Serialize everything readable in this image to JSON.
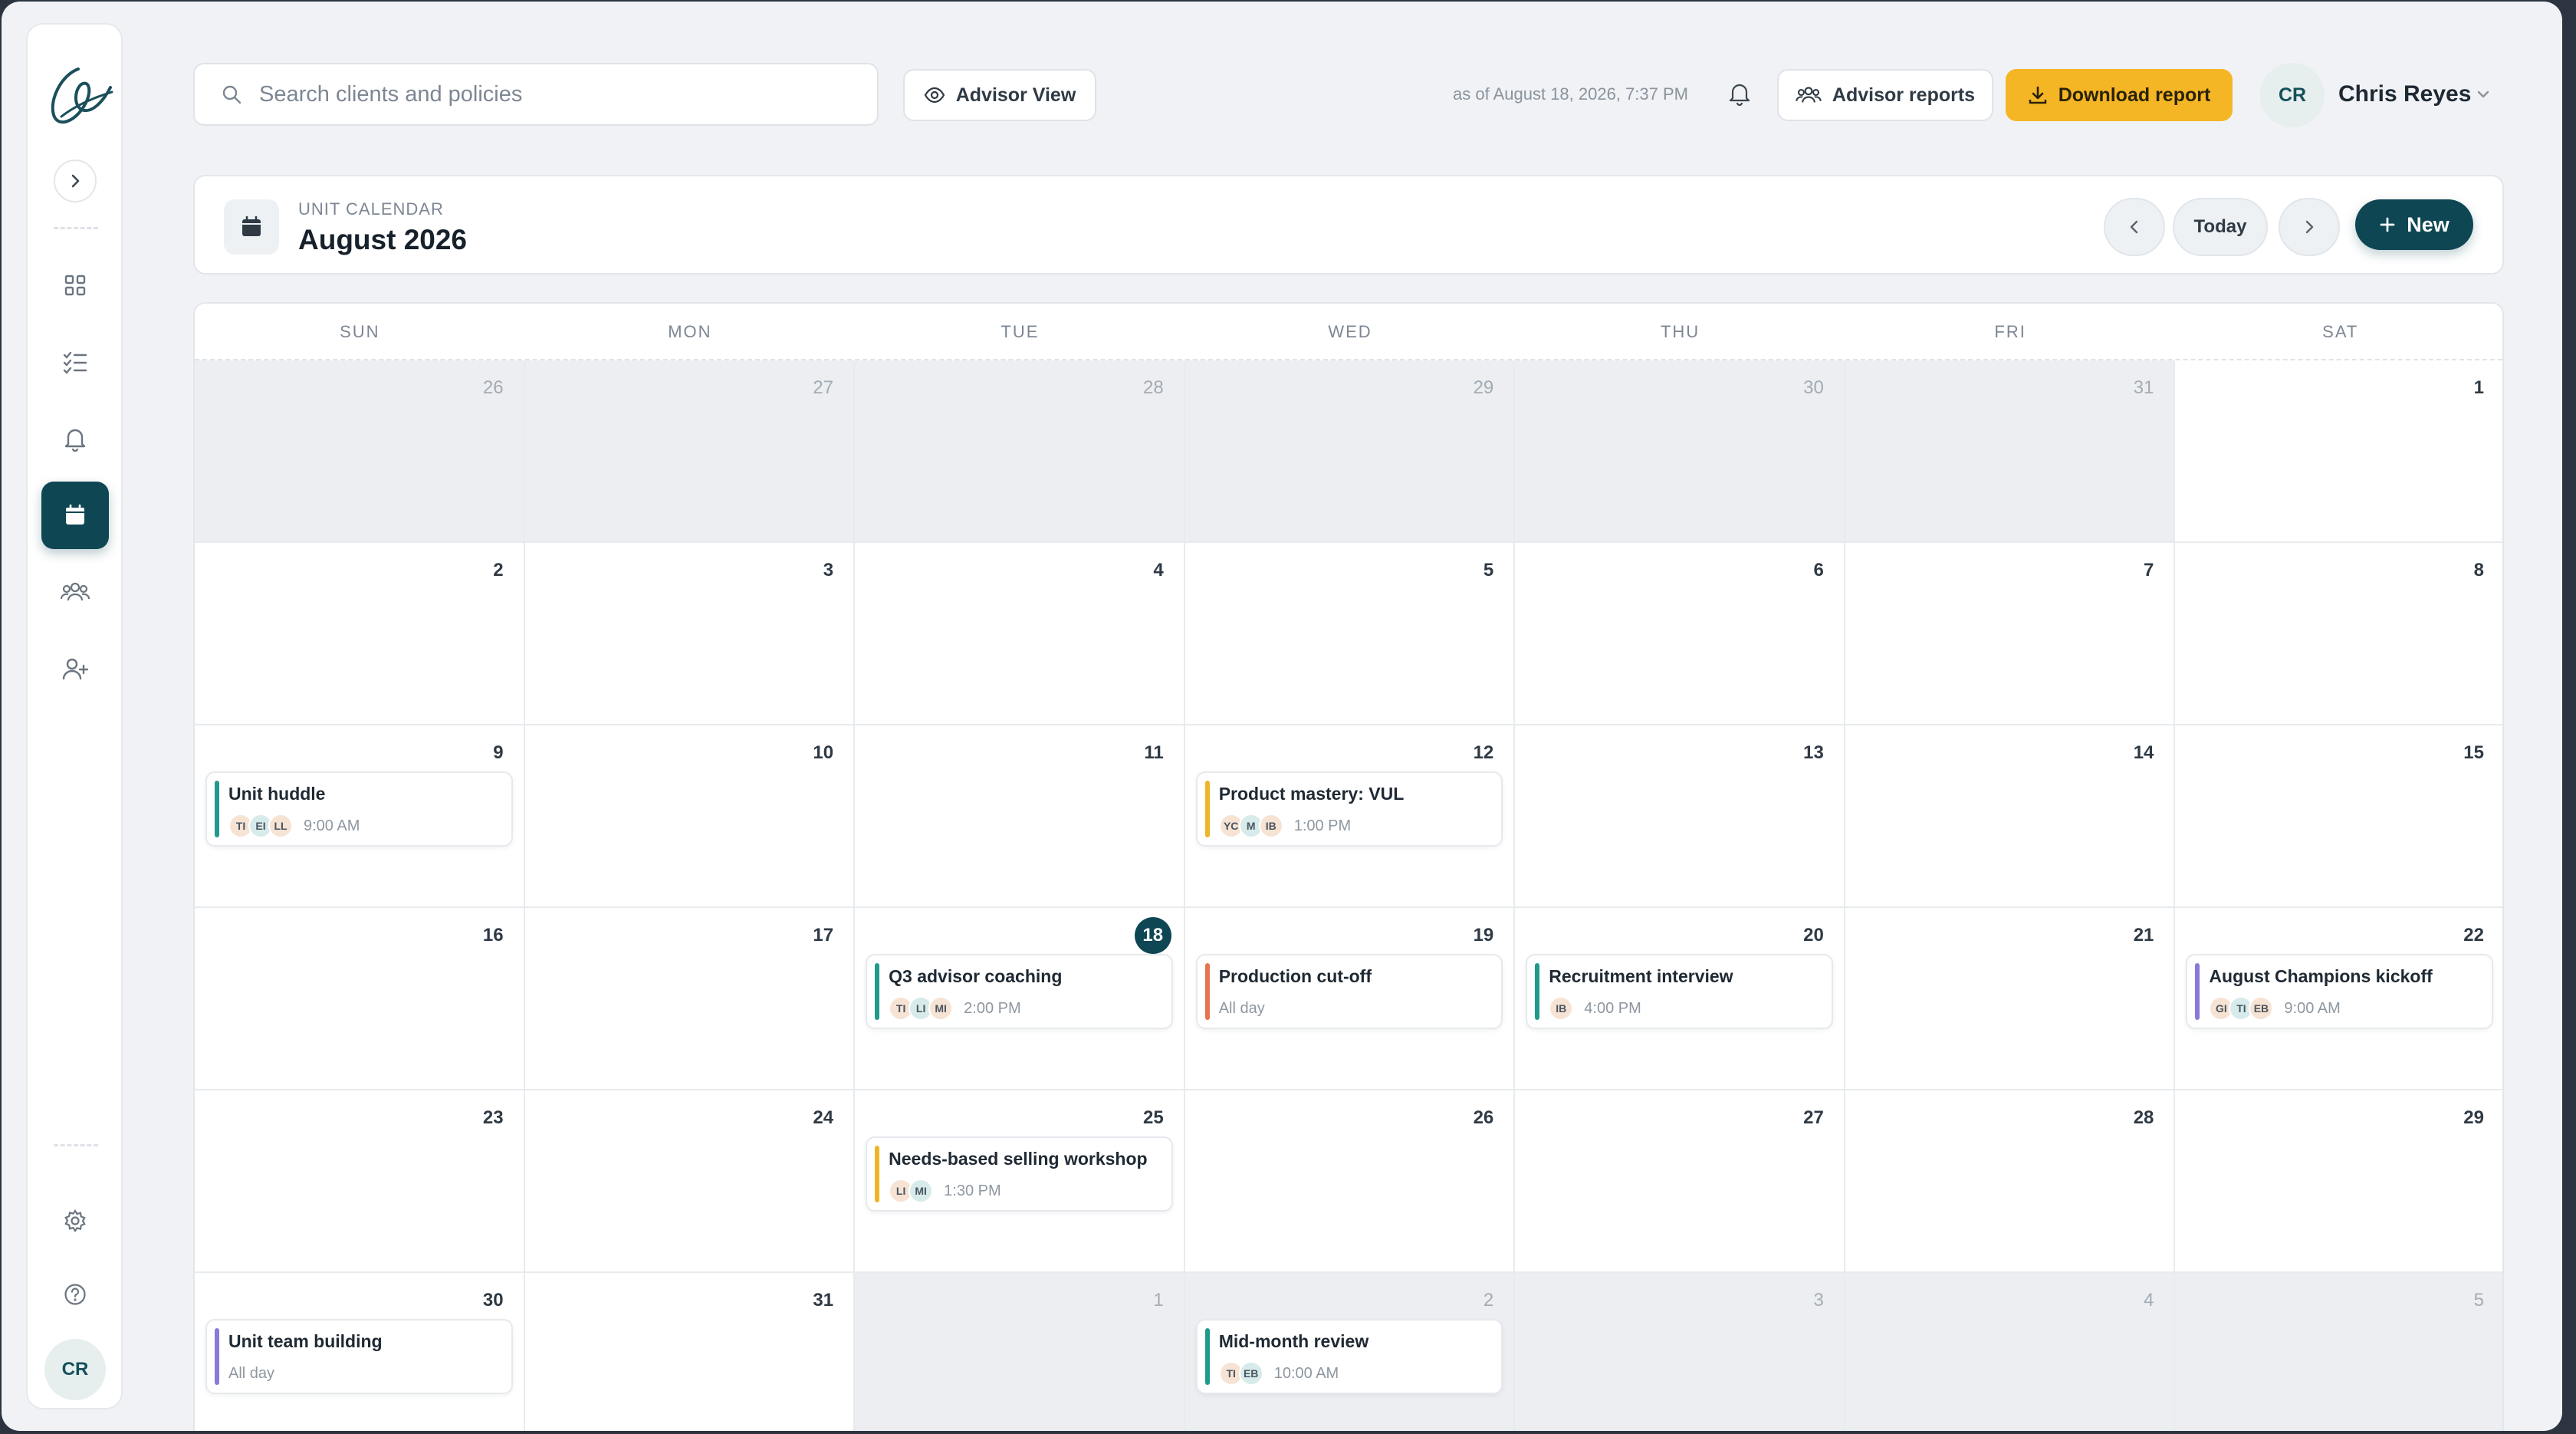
{
  "sidebar": {
    "nav": [
      {
        "icon": "grid-icon"
      },
      {
        "icon": "checklist-icon"
      },
      {
        "icon": "bell-icon"
      },
      {
        "icon": "calendar-icon",
        "active": true
      },
      {
        "icon": "team-icon"
      },
      {
        "icon": "add-user-icon"
      }
    ],
    "avatar_initials": "CR"
  },
  "topbar": {
    "search_placeholder": "Search clients and policies",
    "advisor_view_label": "Advisor View",
    "as_of": "as of August 18, 2026, 7:37 PM",
    "advisor_reports_label": "Advisor reports",
    "download_label": "Download report",
    "user_initials": "CR",
    "user_name": "Chris Reyes"
  },
  "calendar": {
    "eyebrow": "UNIT CALENDAR",
    "title": "August 2026",
    "today_label": "Today",
    "new_label": "New",
    "weekdays": [
      "SUN",
      "MON",
      "TUE",
      "WED",
      "THU",
      "FRI",
      "SAT"
    ],
    "weeks": [
      [
        {
          "d": "26",
          "o": true
        },
        {
          "d": "27",
          "o": true
        },
        {
          "d": "28",
          "o": true
        },
        {
          "d": "29",
          "o": true
        },
        {
          "d": "30",
          "o": true
        },
        {
          "d": "31",
          "o": true
        },
        {
          "d": "1"
        }
      ],
      [
        {
          "d": "2"
        },
        {
          "d": "3"
        },
        {
          "d": "4"
        },
        {
          "d": "5"
        },
        {
          "d": "6"
        },
        {
          "d": "7"
        },
        {
          "d": "8"
        }
      ],
      [
        {
          "d": "9",
          "event": {
            "title": "Unit huddle",
            "color": "#1f9a8c",
            "people": [
              "TI",
              "EI",
              "LL"
            ],
            "time": "9:00 AM"
          }
        },
        {
          "d": "10"
        },
        {
          "d": "11"
        },
        {
          "d": "12",
          "event": {
            "title": "Product mastery: VUL",
            "color": "#f0b429",
            "people": [
              "YC",
              "M",
              "IB"
            ],
            "time": "1:00 PM"
          }
        },
        {
          "d": "13"
        },
        {
          "d": "14"
        },
        {
          "d": "15"
        }
      ],
      [
        {
          "d": "16"
        },
        {
          "d": "17"
        },
        {
          "d": "18",
          "today": true,
          "event": {
            "title": "Q3 advisor coaching",
            "color": "#1f9a8c",
            "people": [
              "TI",
              "LI",
              "MI"
            ],
            "time": "2:00 PM"
          }
        },
        {
          "d": "19",
          "event": {
            "title": "Production cut-off",
            "color": "#e8734f",
            "people": [],
            "time": "All day"
          }
        },
        {
          "d": "20",
          "event": {
            "title": "Recruitment interview",
            "color": "#1f9a8c",
            "people": [
              "IB"
            ],
            "time": "4:00 PM"
          }
        },
        {
          "d": "21"
        },
        {
          "d": "22",
          "event": {
            "title": "August Champions kickoff",
            "color": "#8b78d8",
            "people": [
              "GI",
              "TI",
              "EB"
            ],
            "time": "9:00 AM"
          }
        }
      ],
      [
        {
          "d": "23"
        },
        {
          "d": "24"
        },
        {
          "d": "25",
          "event": {
            "title": "Needs-based selling workshop",
            "color": "#f0b429",
            "people": [
              "LI",
              "MI"
            ],
            "time": "1:30 PM"
          }
        },
        {
          "d": "26"
        },
        {
          "d": "27"
        },
        {
          "d": "28"
        },
        {
          "d": "29"
        }
      ],
      [
        {
          "d": "30",
          "event": {
            "title": "Unit team building",
            "color": "#8b78d8",
            "people": [],
            "time": "All day"
          }
        },
        {
          "d": "31"
        },
        {
          "d": "1",
          "o": true
        },
        {
          "d": "2",
          "o": true,
          "event": {
            "title": "Mid-month review",
            "color": "#1f9a8c",
            "people": [
              "TI",
              "EB"
            ],
            "time": "10:00 AM"
          }
        },
        {
          "d": "3",
          "o": true
        },
        {
          "d": "4",
          "o": true
        },
        {
          "d": "5",
          "o": true
        }
      ]
    ]
  }
}
